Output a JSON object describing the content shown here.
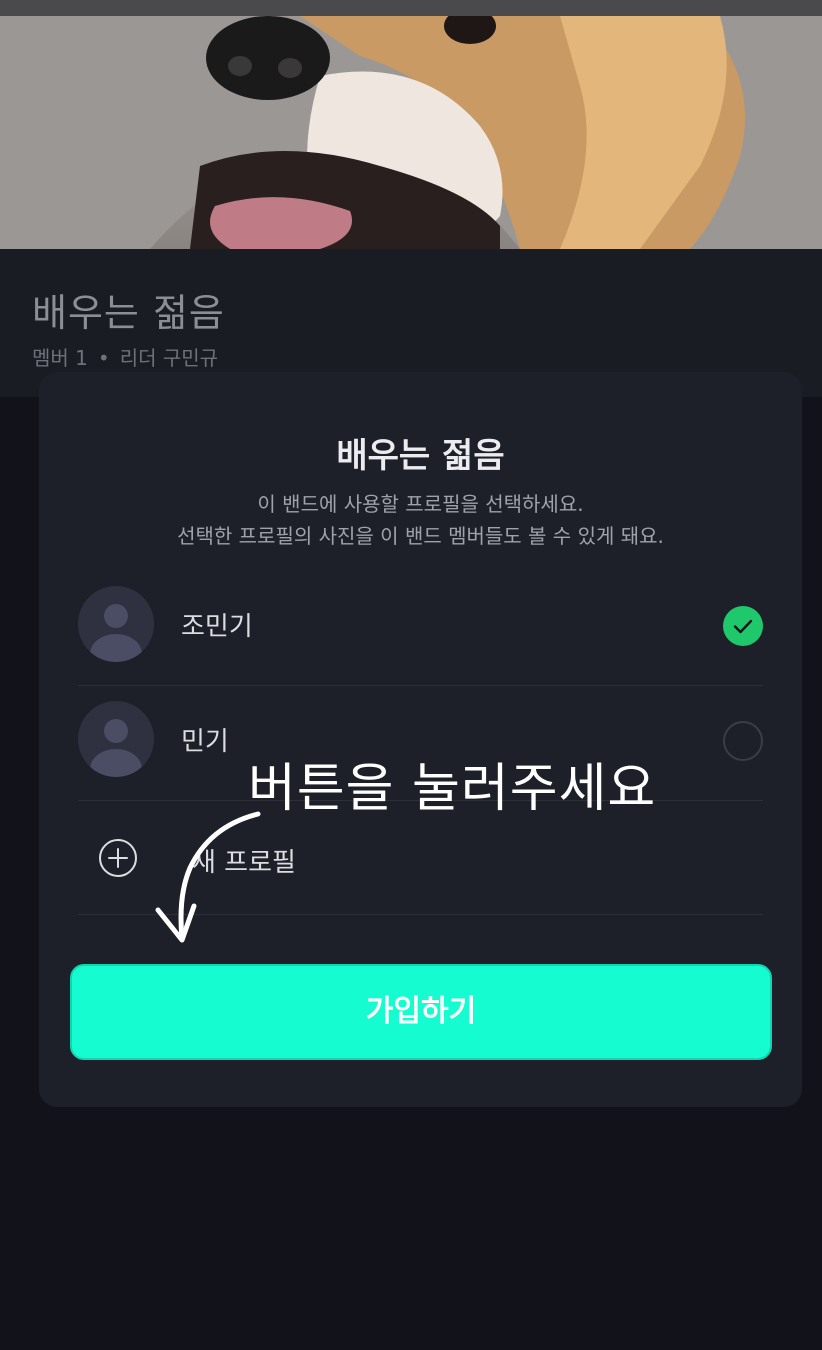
{
  "band": {
    "title": "배우는 젊음",
    "members_label": "멤버 1",
    "separator": "•",
    "leader_label": "리더 구민규"
  },
  "modal": {
    "title": "배우는 젊음",
    "desc_line1": "이 밴드에 사용할 프로필을 선택하세요.",
    "desc_line2": "선택한 프로필의 사진을 이 밴드 멤버들도 볼 수 있게 돼요.",
    "profiles": [
      {
        "name": "조민기",
        "selected": true
      },
      {
        "name": "민기",
        "selected": false
      }
    ],
    "add_profile_label": "새 프로필",
    "join_button_label": "가입하기"
  },
  "annotation": {
    "text": "버튼을 눌러주세요"
  },
  "colors": {
    "join_button": "#15fcd0",
    "check": "#1ec86b",
    "modal_bg": "#1e2029",
    "page_bg": "#12131a"
  },
  "icons": [
    "check-icon",
    "plus-circle-icon",
    "avatar-placeholder-icon",
    "arrow-annotation-icon"
  ]
}
